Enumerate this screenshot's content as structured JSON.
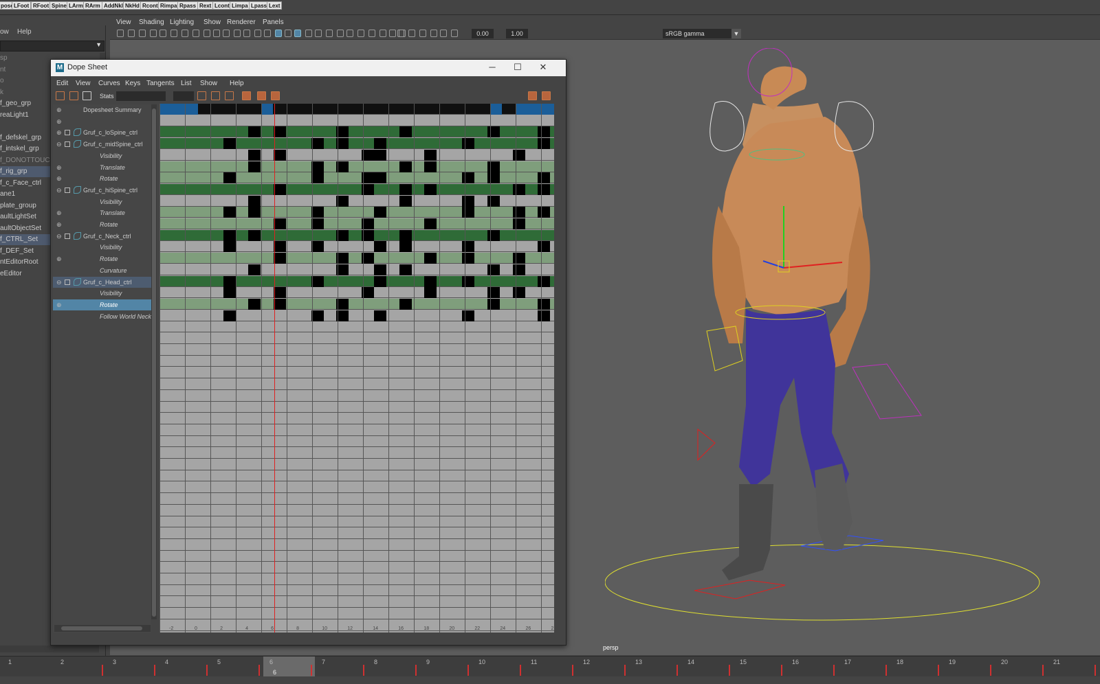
{
  "shelf": [
    "pose",
    "LFoot",
    "RFoot",
    "Spine",
    "LArm",
    "RArm",
    "AddNkl",
    "NkHd",
    "Rcont",
    "Rimpa",
    "Rpass",
    "Rext",
    "Lcont",
    "Limpa",
    "Lpass",
    "Lext"
  ],
  "outliner": {
    "menu": {
      "show": "ow",
      "help": "Help"
    },
    "items": [
      {
        "label": "sp",
        "dim": true
      },
      {
        "label": "nt",
        "dim": true
      },
      {
        "label": "o",
        "dim": true
      },
      {
        "label": "k",
        "dim": true
      },
      {
        "label": "f_geo_grp"
      },
      {
        "label": "reaLight1"
      },
      {
        "label": ""
      },
      {
        "label": "f_defskel_grp"
      },
      {
        "label": "f_intskel_grp"
      },
      {
        "label": "f_DONOTTOUCH",
        "dim": true
      },
      {
        "label": "f_rig_grp",
        "selected": true
      },
      {
        "label": "f_c_Face_ctrl"
      },
      {
        "label": "ane1"
      },
      {
        "label": "plate_group"
      },
      {
        "label": "aultLightSet"
      },
      {
        "label": "aultObjectSet"
      },
      {
        "label": "f_CTRL_Set",
        "selected": true
      },
      {
        "label": "f_DEF_Set"
      },
      {
        "label": "ntEditorRoot"
      },
      {
        "label": "eEditor"
      }
    ]
  },
  "viewport": {
    "menus": [
      "View",
      "Shading",
      "Lighting",
      "Show",
      "Renderer",
      "Panels"
    ],
    "exposure": "0.00",
    "gamma": "1.00",
    "color_space": "sRGB gamma",
    "camera_label": "persp"
  },
  "dope": {
    "title": "Dope Sheet",
    "menus": [
      "Edit",
      "View",
      "Curves",
      "Keys",
      "Tangents",
      "List",
      "Show",
      "Help"
    ],
    "stats_label": "Stats",
    "rows": [
      {
        "label": "Dopesheet Summary",
        "type": "summary"
      },
      {
        "label": "",
        "type": "blank"
      },
      {
        "label": "Gruf_c_loSpine_ctrl",
        "type": "node"
      },
      {
        "label": "Gruf_c_midSpine_ctrl",
        "type": "node"
      },
      {
        "label": "Visibility",
        "type": "attr"
      },
      {
        "label": "Translate",
        "type": "attr"
      },
      {
        "label": "Rotate",
        "type": "attr"
      },
      {
        "label": "Gruf_c_hiSpine_ctrl",
        "type": "node"
      },
      {
        "label": "Visibility",
        "type": "attr"
      },
      {
        "label": "Translate",
        "type": "attr"
      },
      {
        "label": "Rotate",
        "type": "attr"
      },
      {
        "label": "Gruf_c_Neck_ctrl",
        "type": "node"
      },
      {
        "label": "Visibility",
        "type": "attr"
      },
      {
        "label": "Rotate",
        "type": "attr"
      },
      {
        "label": "Curvature",
        "type": "attr"
      },
      {
        "label": "Gruf_c_Head_ctrl",
        "type": "node",
        "highlight": true
      },
      {
        "label": "Visibility",
        "type": "attr"
      },
      {
        "label": "Rotate",
        "type": "attr",
        "selected": true
      },
      {
        "label": "Follow World Neck",
        "type": "attr"
      }
    ],
    "frame_ticks": [
      "-2",
      "0",
      "2",
      "4",
      "6",
      "8",
      "10",
      "12",
      "14",
      "16",
      "18",
      "20",
      "22",
      "24",
      "26",
      "2"
    ],
    "current_frame": "6"
  },
  "timeline": {
    "ticks": [
      "1",
      "2",
      "3",
      "4",
      "5",
      "6",
      "7",
      "8",
      "9",
      "10",
      "11",
      "12",
      "13",
      "14",
      "15",
      "16",
      "17",
      "18",
      "19",
      "20",
      "21"
    ],
    "current": "6"
  },
  "colors": {
    "accent": "#5285a6",
    "key_black": "#000000",
    "row_green": "#2f6b37",
    "attr_green": "#7f9e7c",
    "curtime": "#e02020"
  }
}
